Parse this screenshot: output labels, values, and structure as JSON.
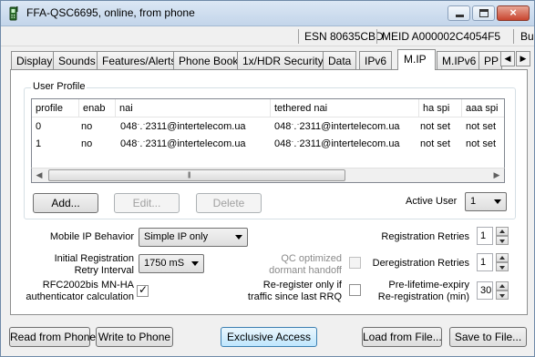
{
  "window": {
    "title": "FFA-QSC6695, online, from phone",
    "minimize_glyph": "",
    "maximize_glyph": "",
    "close_glyph": "×"
  },
  "info": {
    "esn": "ESN 80635CBD",
    "meid": "MEID A000002C4054F5",
    "extra": "Bu"
  },
  "tabs": [
    {
      "label": "Display"
    },
    {
      "label": "Sounds"
    },
    {
      "label": "Features/Alerts"
    },
    {
      "label": "Phone Book"
    },
    {
      "label": "1x/HDR Security"
    },
    {
      "label": "Data"
    },
    {
      "label": "IPv6"
    },
    {
      "label": "M.IP"
    },
    {
      "label": "M.IPv6"
    },
    {
      "label": "PP"
    }
  ],
  "tab_scroll": {
    "left": "◀",
    "right": "▶"
  },
  "active_tab": "M.IP",
  "user_profile": {
    "legend": "User Profile",
    "columns": [
      "profile",
      "enab",
      "nai",
      "tethered nai",
      "ha spi",
      "aaa spi"
    ],
    "rows": [
      [
        "0",
        "no",
        "048ˑ.ˑ2311@intertelecom.ua",
        "048ˑ.ˑ2311@intertelecom.ua",
        "not set",
        "not set"
      ],
      [
        "1",
        "no",
        "048ˑ.ˑ2311@intertelecom.ua",
        "048ˑ.ˑ2311@intertelecom.ua",
        "not set",
        "not set"
      ]
    ],
    "scroll_left": "◀",
    "scroll_right": "▶",
    "scroll_grip": "|||"
  },
  "buttons": {
    "add": "Add...",
    "edit": "Edit...",
    "delete": "Delete",
    "read_from_phone": "Read from Phone",
    "write_to_phone": "Write to Phone",
    "exclusive_access": "Exclusive Access",
    "load_from_file": "Load from File...",
    "save_to_file": "Save to File..."
  },
  "active_user": {
    "label": "Active User",
    "value": "1"
  },
  "settings": {
    "mobile_ip_behavior": {
      "label": "Mobile IP Behavior",
      "value": "Simple IP only"
    },
    "initial_registration": {
      "label_line1": "Initial Registration",
      "label_line2": "Retry Interval",
      "value": "1750 mS"
    },
    "rfc2002": {
      "label_line1": "RFC2002bis MN-HA",
      "label_line2": "authenticator calculation",
      "checked": true,
      "mark": "✓"
    },
    "qc_optimized": {
      "label_line1": "QC optimized",
      "label_line2": "dormant handoff",
      "checked": false,
      "disabled": true
    },
    "reregister": {
      "label_line1": "Re-register only if",
      "label_line2": "traffic since last RRQ",
      "checked": false
    },
    "registration_retries": {
      "label": "Registration Retries",
      "value": "1"
    },
    "deregistration_retries": {
      "label": "Deregistration Retries",
      "value": "1"
    },
    "pre_lifetime": {
      "label_line1": "Pre-lifetime-expiry",
      "label_line2": "Re-registration (min)",
      "value": "30"
    }
  },
  "colors": {
    "accent": "#3c7fb1",
    "title_bg": "#c3d5ea",
    "close_red": "#c8452f"
  }
}
